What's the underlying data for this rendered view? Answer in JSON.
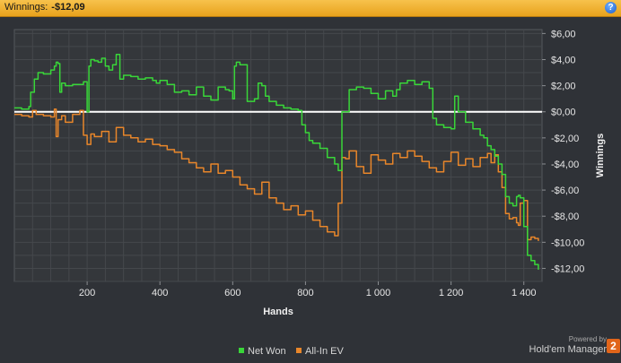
{
  "header": {
    "label": "Winnings:",
    "value": "-$12,09"
  },
  "help_icon": "question-icon",
  "legend": [
    {
      "label": "Net Won",
      "color": "#39d639"
    },
    {
      "label": "All-In EV",
      "color": "#e8862a"
    }
  ],
  "branding": {
    "powered_by": "Powered by",
    "name": "Hold'em Manager",
    "badge": "2"
  },
  "chart_data": {
    "type": "line",
    "xlabel": "Hands",
    "ylabel": "Winnings",
    "xlim": [
      0,
      1450
    ],
    "ylim": [
      -13,
      6.3
    ],
    "x_ticks": [
      200,
      400,
      600,
      800,
      1000,
      1200,
      1400
    ],
    "x_tick_labels": [
      "200",
      "400",
      "600",
      "800",
      "1 000",
      "1 200",
      "1 400"
    ],
    "y_ticks": [
      6,
      4,
      2,
      0,
      -2,
      -4,
      -6,
      -8,
      -10,
      -12
    ],
    "y_tick_labels": [
      "$6,00",
      "$4,00",
      "$2,00",
      "$0,00",
      "-$2,00",
      "-$4,00",
      "-$6,00",
      "-$8,00",
      "-$10,00",
      "-$12,00"
    ],
    "grid": true,
    "zero_line": true,
    "series": [
      {
        "name": "Net Won",
        "color": "#39d639",
        "x": [
          0,
          20,
          40,
          45,
          55,
          65,
          80,
          100,
          110,
          115,
          120,
          125,
          130,
          140,
          160,
          190,
          200,
          205,
          210,
          220,
          230,
          240,
          250,
          260,
          270,
          280,
          290,
          300,
          320,
          340,
          360,
          380,
          390,
          400,
          420,
          440,
          460,
          480,
          500,
          520,
          540,
          560,
          580,
          590,
          600,
          605,
          610,
          620,
          640,
          660,
          670,
          680,
          690,
          700,
          720,
          740,
          760,
          780,
          790,
          800,
          810,
          820,
          840,
          860,
          880,
          890,
          900,
          910,
          920,
          940,
          960,
          980,
          1000,
          1020,
          1040,
          1050,
          1060,
          1080,
          1100,
          1120,
          1140,
          1150,
          1160,
          1180,
          1200,
          1210,
          1220,
          1240,
          1260,
          1280,
          1290,
          1300,
          1310,
          1320,
          1330,
          1340,
          1350,
          1360,
          1370,
          1380,
          1385,
          1390,
          1400,
          1410,
          1420,
          1430,
          1440
        ],
        "y": [
          0.3,
          0.2,
          0.4,
          1.5,
          2.5,
          3.0,
          2.9,
          3.2,
          3.5,
          3.8,
          3.7,
          1.5,
          2.2,
          2.0,
          2.1,
          2.3,
          0.0,
          3.5,
          4.0,
          3.9,
          3.8,
          4.1,
          3.5,
          3.2,
          3.6,
          4.4,
          2.5,
          2.8,
          2.7,
          2.5,
          2.6,
          2.4,
          2.2,
          2.4,
          2.1,
          1.5,
          1.6,
          1.3,
          1.9,
          1.2,
          0.9,
          1.9,
          1.7,
          1.6,
          1.0,
          3.5,
          3.8,
          3.6,
          0.8,
          1.0,
          2.2,
          2.0,
          1.2,
          0.8,
          0.5,
          0.3,
          0.2,
          0.1,
          -1.0,
          -1.6,
          -2.2,
          -2.4,
          -2.8,
          -3.5,
          -4.0,
          -4.5,
          0.0,
          0.0,
          1.7,
          1.9,
          1.8,
          1.4,
          1.0,
          1.6,
          1.2,
          1.7,
          2.2,
          2.4,
          2.1,
          2.3,
          1.8,
          -0.5,
          -1.0,
          -1.2,
          -1.3,
          1.2,
          0.0,
          -0.8,
          -1.3,
          -1.8,
          -2.0,
          -2.6,
          -2.9,
          -3.4,
          -4.0,
          -4.8,
          -6.5,
          -7.0,
          -7.2,
          -6.5,
          -6.4,
          -6.6,
          -8.8,
          -11.0,
          -11.4,
          -11.7,
          -12.1
        ]
      },
      {
        "name": "All-In EV",
        "color": "#e8862a",
        "x": [
          0,
          20,
          40,
          50,
          60,
          80,
          100,
          110,
          115,
          120,
          130,
          140,
          160,
          180,
          190,
          200,
          210,
          220,
          240,
          260,
          280,
          300,
          320,
          340,
          360,
          380,
          400,
          420,
          440,
          460,
          480,
          500,
          520,
          540,
          560,
          580,
          600,
          620,
          640,
          660,
          680,
          700,
          720,
          740,
          760,
          780,
          800,
          820,
          840,
          860,
          880,
          890,
          900,
          910,
          920,
          940,
          960,
          980,
          1000,
          1020,
          1040,
          1060,
          1080,
          1100,
          1120,
          1140,
          1160,
          1180,
          1200,
          1220,
          1240,
          1260,
          1280,
          1300,
          1310,
          1320,
          1330,
          1340,
          1350,
          1360,
          1370,
          1380,
          1385,
          1390,
          1400,
          1410,
          1420,
          1430,
          1440
        ],
        "y": [
          -0.2,
          -0.3,
          -0.4,
          0.1,
          -0.2,
          -0.3,
          -0.4,
          0.2,
          -1.9,
          -0.6,
          -0.3,
          -0.8,
          -0.2,
          0.1,
          -1.8,
          -2.5,
          -1.7,
          -1.9,
          -1.5,
          -2.3,
          -1.2,
          -1.8,
          -2.0,
          -2.3,
          -2.1,
          -2.5,
          -2.6,
          -2.9,
          -3.1,
          -3.6,
          -3.9,
          -4.3,
          -4.6,
          -4.0,
          -4.7,
          -4.5,
          -5.0,
          -5.6,
          -5.9,
          -6.3,
          -5.4,
          -6.6,
          -7.0,
          -7.5,
          -7.2,
          -7.9,
          -7.6,
          -8.3,
          -8.8,
          -9.2,
          -9.5,
          -7.0,
          -3.5,
          -3.6,
          -3.0,
          -4.2,
          -4.7,
          -3.3,
          -3.7,
          -4.0,
          -3.2,
          -3.5,
          -3.0,
          -3.4,
          -3.8,
          -4.3,
          -4.6,
          -3.8,
          -3.1,
          -4.1,
          -3.6,
          -4.2,
          -3.5,
          -3.2,
          -3.9,
          -3.3,
          -4.6,
          -5.8,
          -7.8,
          -8.2,
          -8.1,
          -8.5,
          -8.7,
          -7.0,
          -6.8,
          -9.8,
          -9.6,
          -9.7,
          -9.9
        ]
      }
    ]
  }
}
